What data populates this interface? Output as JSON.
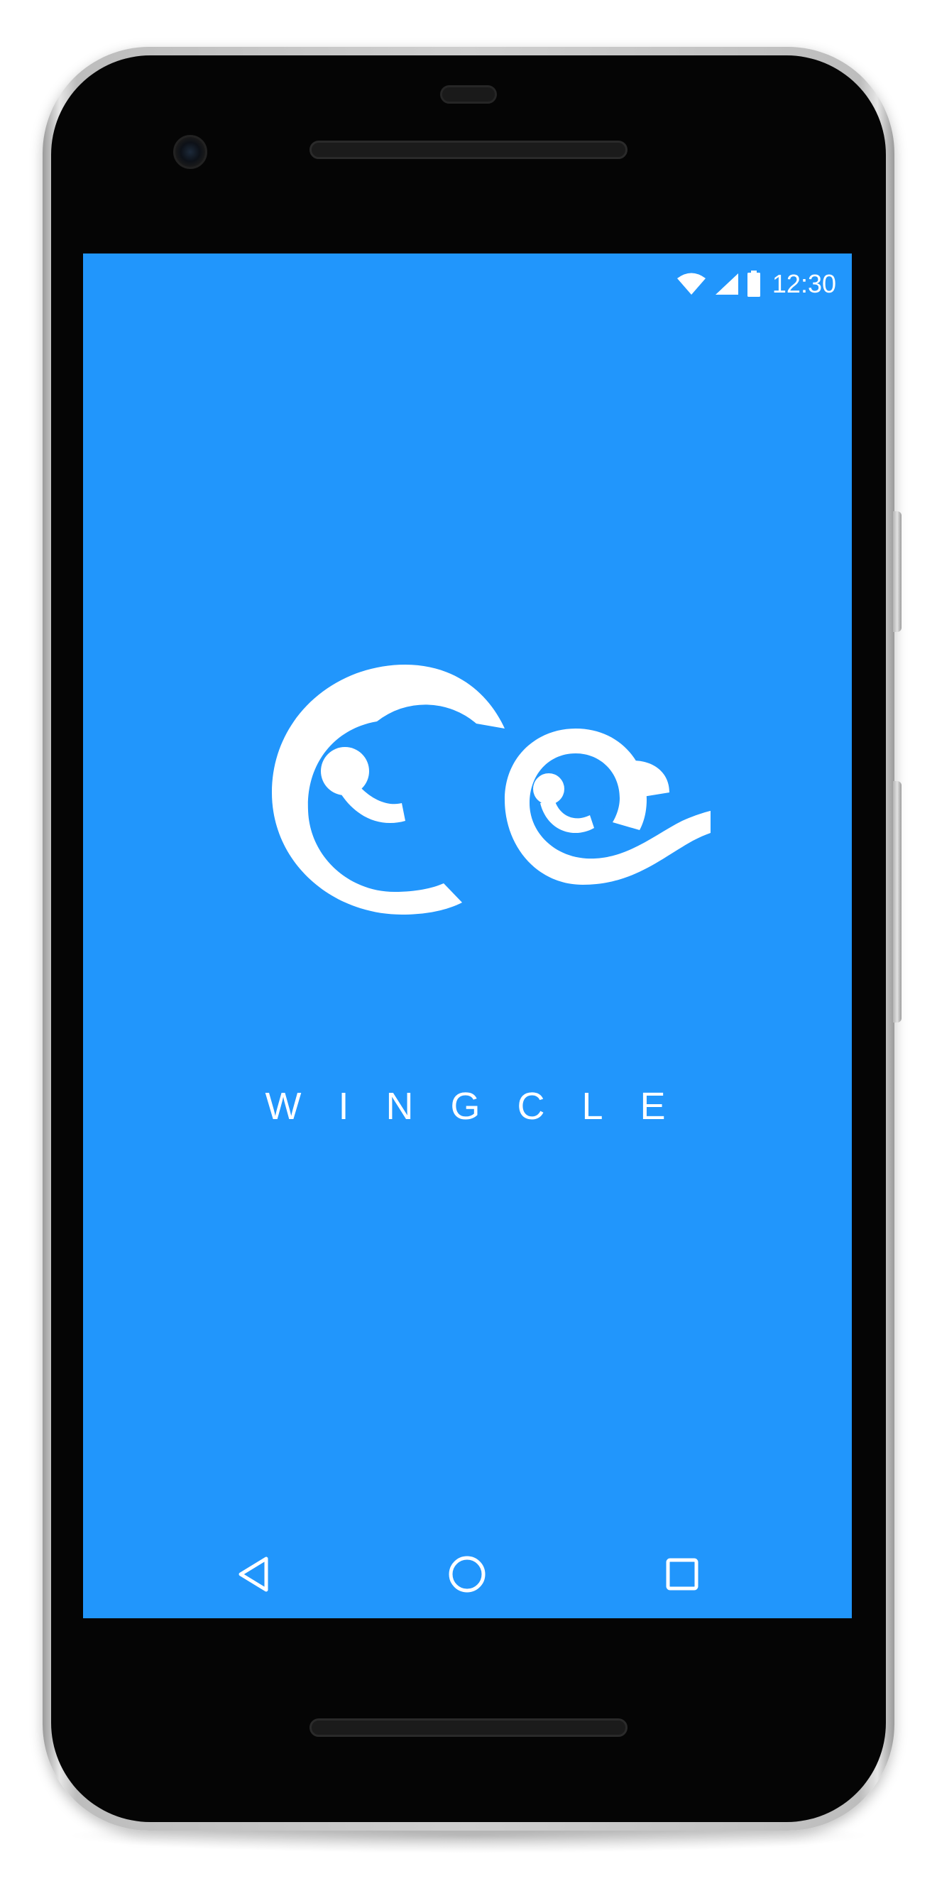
{
  "status_bar": {
    "time": "12:30",
    "icons": [
      "wifi-icon",
      "cell-signal-icon",
      "battery-icon"
    ]
  },
  "splash": {
    "app_name": "WINGCLE",
    "logo": "wingcle-swirl-logo"
  },
  "nav_bar": {
    "buttons": [
      "back-icon",
      "home-icon",
      "recents-icon"
    ]
  },
  "colors": {
    "screen_background": "#2196fc",
    "foreground": "#ffffff",
    "device_body": "#050505"
  }
}
